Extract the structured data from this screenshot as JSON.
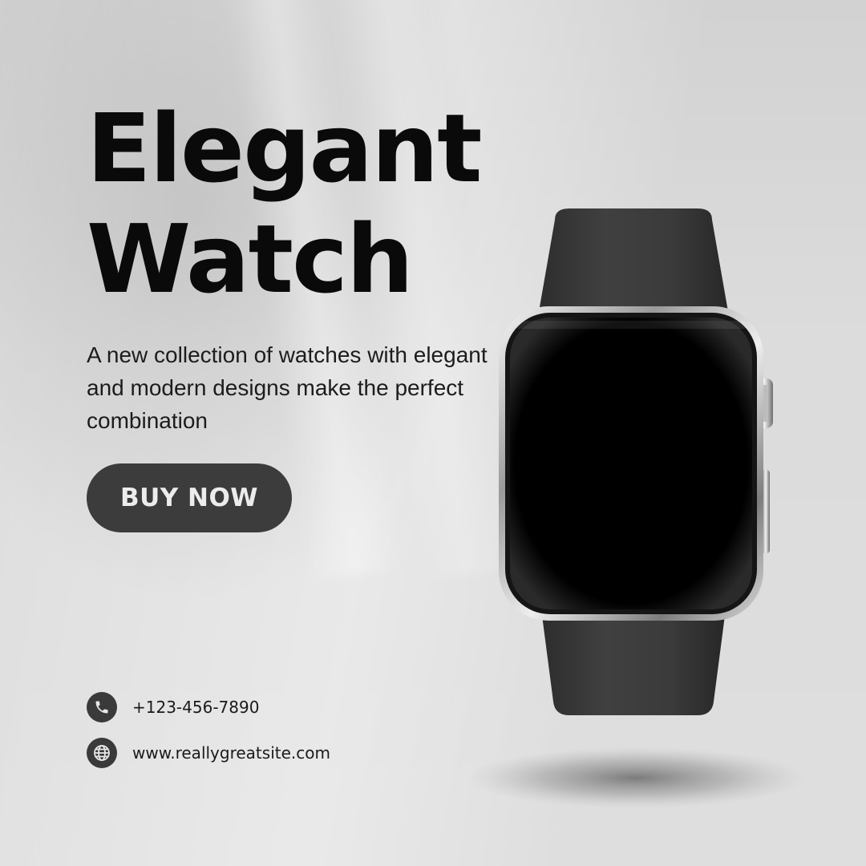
{
  "headline": {
    "line1": "Elegant",
    "line2": "Watch"
  },
  "description": "A new collection of watches with elegant and modern designs make the perfect combination",
  "cta": {
    "label": "BUY NOW"
  },
  "contact": {
    "phone": "+123-456-7890",
    "website": "www.reallygreatsite.com"
  },
  "icons": {
    "phone": "phone-icon",
    "website": "globe-icon",
    "product": "smartwatch"
  },
  "colors": {
    "background": "#dcdcdc",
    "headline": "#0a0a0a",
    "button": "#3b3c3b",
    "button_text": "#ececec",
    "strap": "#3a3b3a",
    "screen": "#000000"
  }
}
